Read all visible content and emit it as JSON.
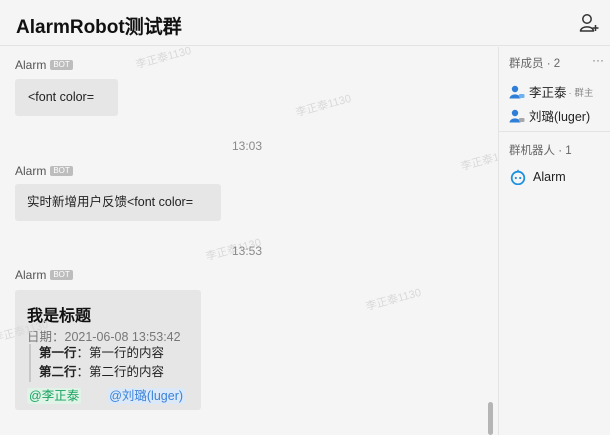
{
  "header": {
    "title": "AlarmRobot测试群"
  },
  "watermark": "李正泰1130",
  "messages": [
    {
      "sender": "Alarm",
      "badge": "BOT",
      "text": "<font color="
    },
    {
      "time": "13:03"
    },
    {
      "sender": "Alarm",
      "badge": "BOT",
      "text": "实时新增用户反馈<font color="
    },
    {
      "time": "13:53"
    },
    {
      "sender": "Alarm",
      "badge": "BOT"
    }
  ],
  "card": {
    "title": "我是标题",
    "date": "日期：2021-06-08 13:53:42",
    "rows": [
      {
        "label": "第一行",
        "sep": "：",
        "value": "第一行的内容"
      },
      {
        "label": "第二行",
        "sep": "：",
        "value": "第二行的内容"
      }
    ],
    "mentions": [
      "@李正泰",
      "@刘璐(luger)"
    ]
  },
  "sidebar": {
    "members_heading": "群成员 · 2",
    "more": "···",
    "members": [
      {
        "name": "李正泰",
        "role": "· 群主"
      },
      {
        "name": "刘璐(luger)"
      }
    ],
    "bots_heading": "群机器人 · 1",
    "bots": [
      {
        "name": "Alarm"
      }
    ]
  },
  "colors": {
    "mention_green": "#1aa260",
    "mention_blue": "#3a82d8",
    "member_icon": "#2f7fd8",
    "bot_icon": "#1e90e0"
  }
}
